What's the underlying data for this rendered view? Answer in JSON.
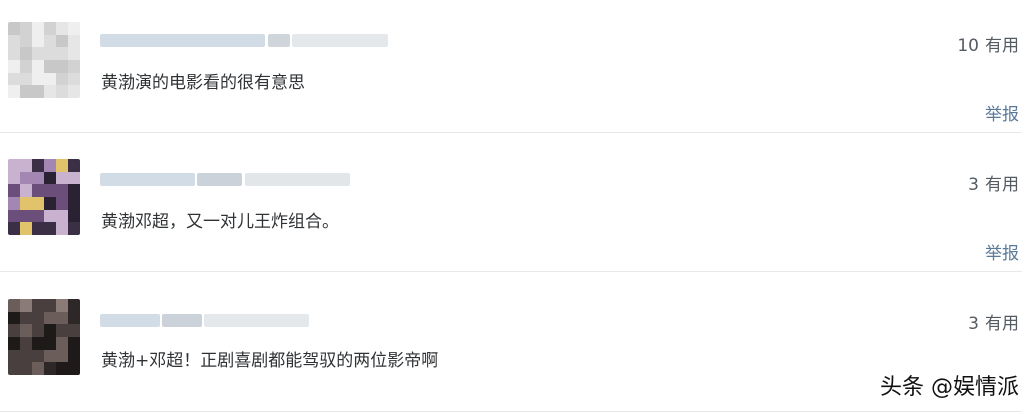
{
  "comments": [
    {
      "useful_count": "10",
      "useful_label": "有用",
      "text": "黄渤演的电影看的很有意思",
      "report_label": "举报",
      "avatar_palette": [
        "#e6e6e6",
        "#dcdcdc",
        "#d2d2d2",
        "#c8c8c8",
        "#efefef"
      ]
    },
    {
      "useful_count": "3",
      "useful_label": "有用",
      "text": "黄渤邓超，又一对儿王炸组合。",
      "report_label": "举报",
      "avatar_palette": [
        "#3b2f45",
        "#6b4f7a",
        "#a486b3",
        "#c9b2cf",
        "#2a2233",
        "#e0c36a"
      ]
    },
    {
      "useful_count": "3",
      "useful_label": "有用",
      "text": "黄渤+邓超！正剧喜剧都能驾驭的两位影帝啊",
      "report_label": "",
      "avatar_palette": [
        "#2e2727",
        "#4a3f3f",
        "#6b5d5a",
        "#8a7b76",
        "#1f1a1a"
      ]
    }
  ],
  "watermark": "头条 @娱情派",
  "colors": {
    "text": "#303336",
    "count": "#555b62",
    "report_link": "#5a7a99",
    "divider": "#e7e9ec",
    "name_blur": "#c9d6e3"
  }
}
